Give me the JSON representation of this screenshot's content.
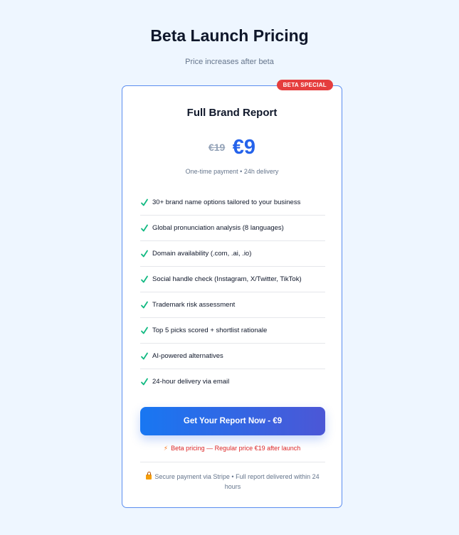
{
  "header": {
    "title": "Beta Launch Pricing",
    "subtitle": "Price increases after beta"
  },
  "card": {
    "badge": "BETA SPECIAL",
    "title": "Full Brand Report",
    "old_price": "€19",
    "new_price": "€9",
    "price_note": "One-time payment • 24h delivery",
    "features": [
      {
        "label": "30+ brand name options tailored to your business",
        "icon": "check-icon"
      },
      {
        "label": "Global pronunciation analysis (8 languages)",
        "icon": "check-icon"
      },
      {
        "label": "Domain availability (.com, .ai, .io)",
        "icon": "check-icon"
      },
      {
        "label": "Social handle check (Instagram, X/Twitter, TikTok)",
        "icon": "check-icon"
      },
      {
        "label": "Trademark risk assessment",
        "icon": "check-icon"
      },
      {
        "label": "Top 5 picks scored + shortlist rationale",
        "icon": "check-icon"
      },
      {
        "label": "AI-powered alternatives",
        "icon": "check-icon"
      },
      {
        "label": "24-hour delivery via email",
        "icon": "check-icon"
      }
    ],
    "cta_label": "Get Your Report Now - €9",
    "beta_note": "Beta pricing — Regular price €19 after launch",
    "secure_note": "Secure payment via Stripe • Full report delivered within 24 hours"
  },
  "colors": {
    "page_background": "#eef6ff",
    "accent": "#2563eb",
    "badge": "#e53e3e",
    "check": "#10b981",
    "cta_gradient_start": "#1877f2",
    "cta_gradient_end": "#4c57d6",
    "beta_note": "#dc2626"
  }
}
